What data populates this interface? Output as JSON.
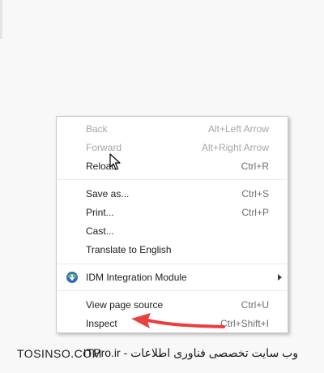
{
  "context_menu": {
    "groups": [
      {
        "items": [
          {
            "label": "Back",
            "shortcut": "Alt+Left Arrow",
            "enabled": false
          },
          {
            "label": "Forward",
            "shortcut": "Alt+Right Arrow",
            "enabled": false
          },
          {
            "label": "Reload",
            "shortcut": "Ctrl+R",
            "enabled": true
          }
        ]
      },
      {
        "items": [
          {
            "label": "Save as...",
            "shortcut": "Ctrl+S",
            "enabled": true
          },
          {
            "label": "Print...",
            "shortcut": "Ctrl+P",
            "enabled": true
          },
          {
            "label": "Cast...",
            "shortcut": "",
            "enabled": true
          },
          {
            "label": "Translate to English",
            "shortcut": "",
            "enabled": true
          }
        ]
      },
      {
        "items": [
          {
            "label": "IDM Integration Module",
            "shortcut": "",
            "enabled": true,
            "icon": "idm-icon",
            "submenu": true
          }
        ]
      },
      {
        "items": [
          {
            "label": "View page source",
            "shortcut": "Ctrl+U",
            "enabled": true
          },
          {
            "label": "Inspect",
            "shortcut": "Ctrl+Shift+I",
            "enabled": true
          }
        ]
      }
    ]
  },
  "annotation": {
    "arrow_color": "#e8403f",
    "target": "Inspect"
  },
  "watermark": {
    "left_text": "TOSINSO.COM",
    "right_text": "وب سایت تخصصی فناوری اطلاعات - ITPro.ir"
  },
  "colors": {
    "menu_text": "#1d1d1d",
    "disabled_text": "#a6a6a6",
    "arrow": "#e8403f"
  }
}
